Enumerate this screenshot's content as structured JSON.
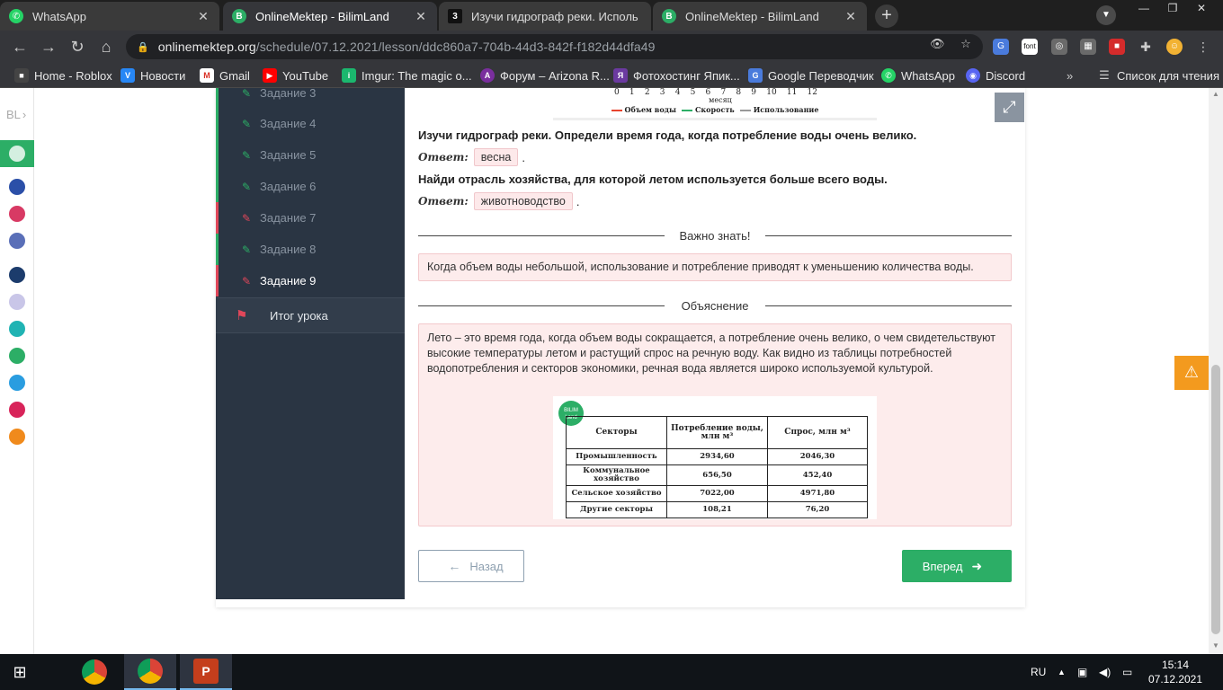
{
  "tabs": [
    {
      "title": "WhatsApp",
      "icon": "whatsapp-icon",
      "color": "#25d366"
    },
    {
      "title": "OnlineMektep - BilimLand",
      "icon": "bilimland-icon",
      "color": "#2cae66"
    },
    {
      "title": "Изучи гидрограф реки. Исполь",
      "icon": "tab-3-icon",
      "color": "#111111"
    },
    {
      "title": "OnlineMektep - BilimLand",
      "icon": "bilimland-icon",
      "color": "#2cae66"
    }
  ],
  "address": {
    "domain": "onlinemektep.org",
    "path": "/schedule/07.12.2021/lesson/ddc860a7-704b-44d3-842f-f182d44dfa49"
  },
  "bookmarks": [
    {
      "label": "Home - Roblox"
    },
    {
      "label": "Новости"
    },
    {
      "label": "Gmail"
    },
    {
      "label": "YouTube"
    },
    {
      "label": "Imgur: The magic o..."
    },
    {
      "label": "Форум – Arizona R..."
    },
    {
      "label": "Фотохостинг Япик..."
    },
    {
      "label": "Google Переводчик"
    },
    {
      "label": "WhatsApp"
    },
    {
      "label": "Discord"
    },
    {
      "label": "Список для чтения"
    }
  ],
  "extension_font_label": "font",
  "rail": {
    "logo_text": "BL"
  },
  "nav": {
    "items": [
      {
        "label": "Задание 3",
        "status": "ok"
      },
      {
        "label": "Задание 4",
        "status": "ok"
      },
      {
        "label": "Задание 5",
        "status": "ok"
      },
      {
        "label": "Задание 6",
        "status": "ok"
      },
      {
        "label": "Задание 7",
        "status": "bad"
      },
      {
        "label": "Задание 8",
        "status": "ok"
      },
      {
        "label": "Задание 9",
        "status": "bad"
      }
    ],
    "summary": "Итог урока"
  },
  "graph": {
    "ticks": [
      "0",
      "1",
      "2",
      "3",
      "4",
      "5",
      "6",
      "7",
      "8",
      "9",
      "10",
      "11",
      "12"
    ],
    "xlabel": "месяц",
    "legend": [
      {
        "label": "Объем воды",
        "color": "#e8442e"
      },
      {
        "label": "Скорость",
        "color": "#2cae66"
      },
      {
        "label": "Использование",
        "color": "#999999"
      }
    ]
  },
  "task": {
    "q1": "Изучи гидрограф реки. Определи время года, когда потребление воды очень велико.",
    "answer_label": "Ответ:",
    "a1": "весна",
    "q2": "Найди отрасль хозяйства, для которой летом используется больше всего воды.",
    "a2": "животноводство",
    "dot": "."
  },
  "important": {
    "heading": "Важно знать!",
    "text": "Когда объем воды небольшой, использование и потребление приводят к уменьшению количества воды."
  },
  "explanation": {
    "heading": "Объяснение",
    "text": "Лето – это время года, когда объем воды сокращается, а потребление очень велико, о чем свидетельствуют высокие температуры летом и растущий спрос на речную воду. Как видно из таблицы потребностей водопотребления и секторов экономики, речная вода является широко используемой культурой."
  },
  "table": {
    "badge": "BILIM Land",
    "headers": [
      "Секторы",
      "Потребление воды, млн м³",
      "Спрос, млн м³"
    ],
    "rows": [
      [
        "Промышленность",
        "2934,60",
        "2046,30"
      ],
      [
        "Коммунальное хозяйство",
        "656,50",
        "452,40"
      ],
      [
        "Сельское хозяйство",
        "7022,00",
        "4971,80"
      ],
      [
        "Другие секторы",
        "108,21",
        "76,20"
      ]
    ]
  },
  "buttons": {
    "back": "Назад",
    "next": "Вперед"
  },
  "taskbar": {
    "lang": "RU",
    "time": "15:14",
    "date": "07.12.2021"
  }
}
